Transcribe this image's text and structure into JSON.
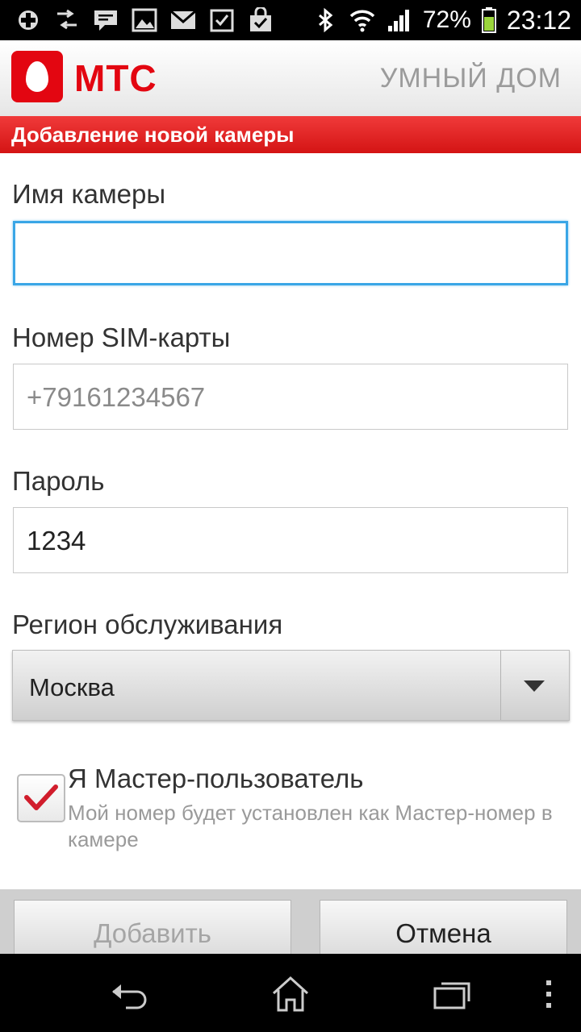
{
  "status_bar": {
    "battery": "72%",
    "time": "23:12"
  },
  "header": {
    "brand": "МТС",
    "app_title": "УМНЫЙ ДОМ"
  },
  "page": {
    "title": "Добавление новой камеры"
  },
  "form": {
    "camera_name": {
      "label": "Имя камеры",
      "value": ""
    },
    "sim_number": {
      "label": "Номер SIM-карты",
      "placeholder": "+79161234567"
    },
    "password": {
      "label": "Пароль",
      "value": "1234"
    },
    "region": {
      "label": "Регион обслуживания",
      "selected": "Москва"
    },
    "master": {
      "checked": true,
      "label": "Я Мастер-пользователь",
      "description": "Мой номер будет установлен как Мастер-номер в камере"
    }
  },
  "buttons": {
    "add": "Добавить",
    "cancel": "Отмена"
  },
  "colors": {
    "brand_red": "#e30611",
    "focus_blue": "#3aa6e6"
  },
  "icons": {
    "status_left": [
      "plus-icon",
      "data-transfer-icon",
      "message-icon",
      "gallery-icon",
      "gmail-icon",
      "task-icon",
      "shopping-bag-icon"
    ],
    "status_right": [
      "bluetooth-off-icon",
      "wifi-icon",
      "signal-icon",
      "battery-icon"
    ],
    "nav": [
      "back-icon",
      "home-icon",
      "recent-apps-icon",
      "menu-icon"
    ]
  }
}
